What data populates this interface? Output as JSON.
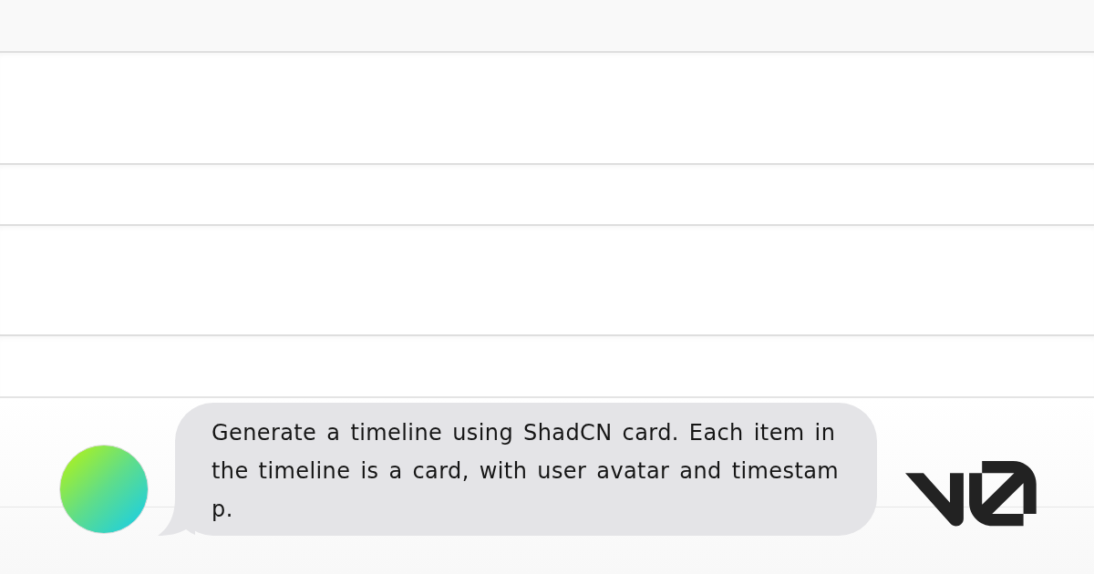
{
  "message": {
    "lines": [
      "Generate a timeline using ShadCN card. Each item in",
      "the timeline is a card, with user avatar and timestam",
      "p."
    ]
  }
}
